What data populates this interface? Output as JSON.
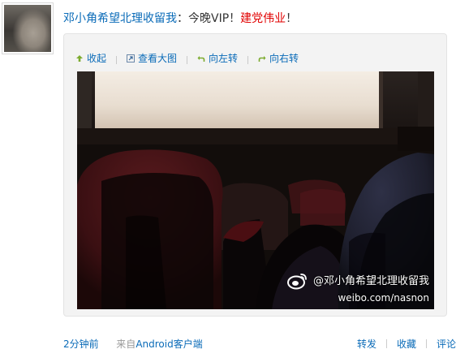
{
  "post": {
    "author": "邓小角希望北理收留我",
    "separator": "：",
    "text": "今晚VIP！",
    "topic": "建党伟业",
    "text_end": "！"
  },
  "toolbar": {
    "collapse": "收起",
    "view_large": "查看大图",
    "rotate_left": "向左转",
    "rotate_right": "向右转"
  },
  "image": {
    "watermark_name": "@邓小角希望北理收留我",
    "watermark_url": "weibo.com/nasnon"
  },
  "footer": {
    "time": "2分钟前",
    "source_prefix": "来自",
    "source_client": "Android客户端",
    "forward": "转发",
    "favorite": "收藏",
    "comment": "评论"
  },
  "colors": {
    "link": "#0a6bb8",
    "topic": "#e10000"
  }
}
